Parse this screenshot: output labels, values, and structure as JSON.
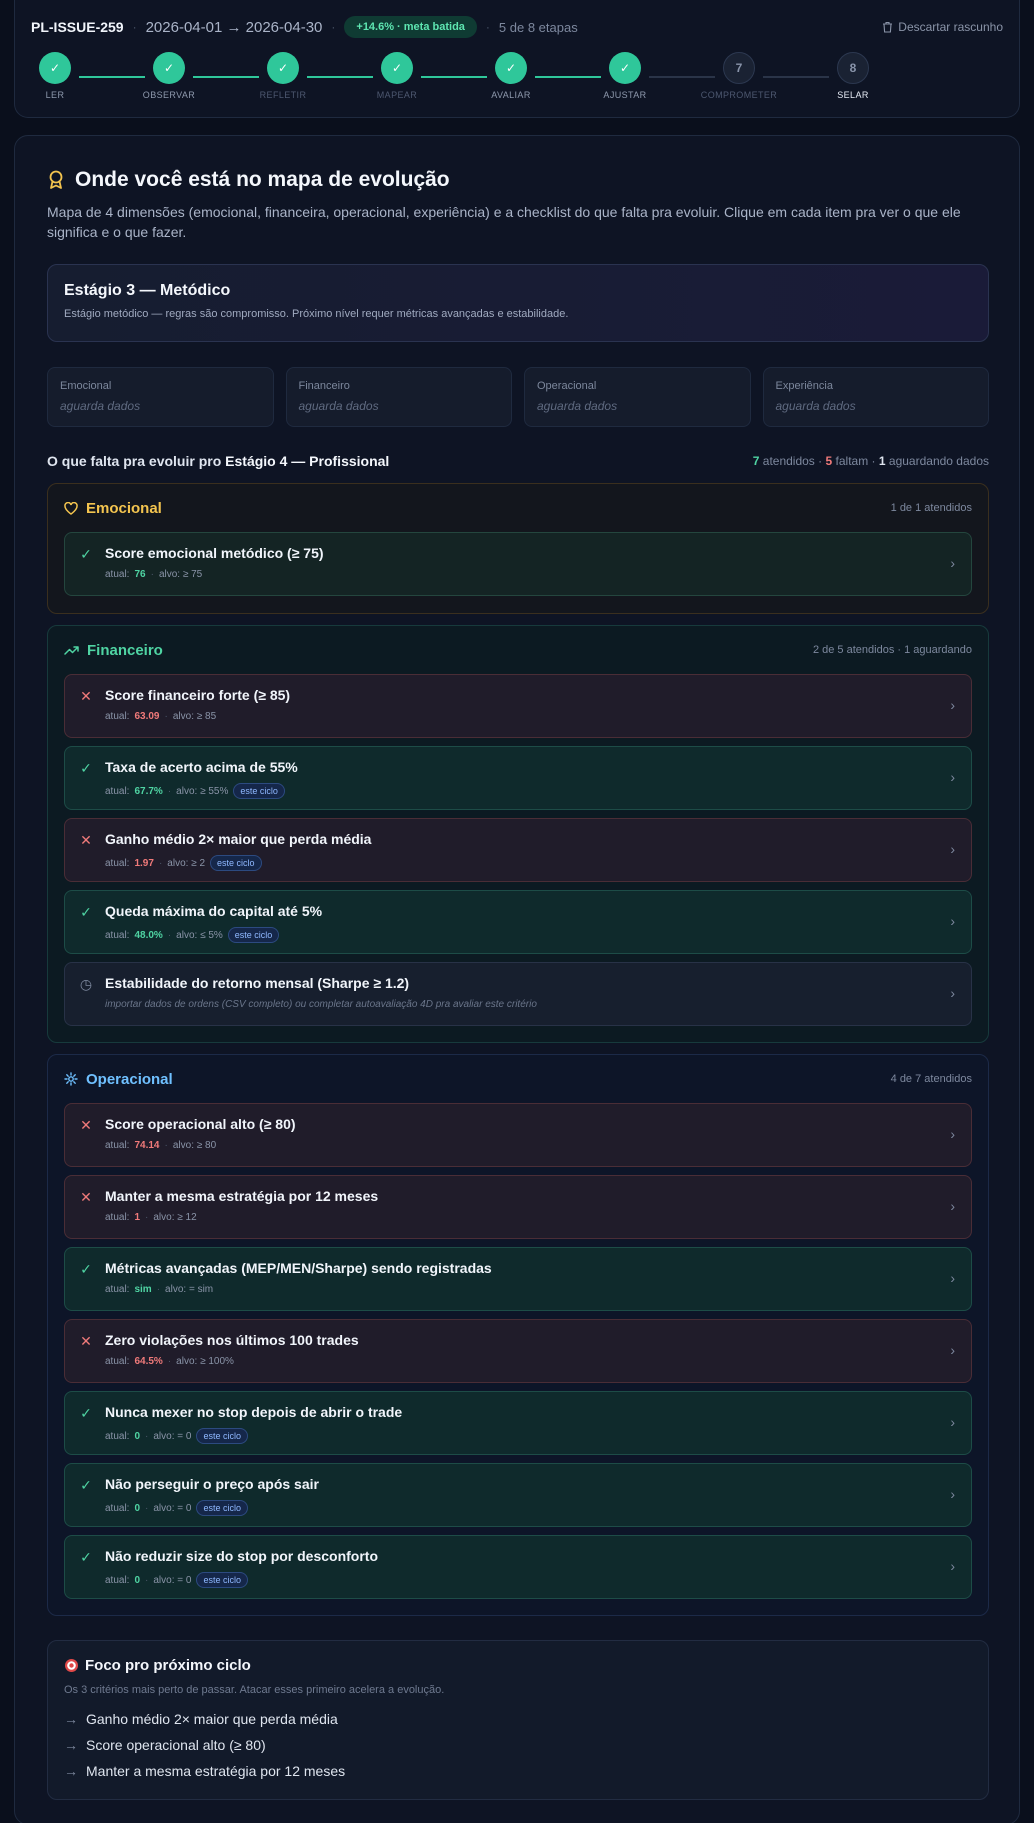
{
  "header": {
    "issue_id": "PL-ISSUE-259",
    "period": "2026-04-01 → 2026-04-30",
    "meta_badge": "+14.6% · meta batida",
    "steps_progress": "5 de 8 etapas",
    "discard_label": "Descartar rascunho"
  },
  "steps": [
    {
      "label": "LER",
      "state": "done",
      "marker": "✓"
    },
    {
      "label": "OBSERVAR",
      "state": "done",
      "marker": "✓"
    },
    {
      "label": "REFLETIR",
      "state": "done",
      "marker": "✓"
    },
    {
      "label": "MAPEAR",
      "state": "done",
      "marker": "✓"
    },
    {
      "label": "AVALIAR",
      "state": "done",
      "marker": "✓"
    },
    {
      "label": "AJUSTAR",
      "state": "done",
      "marker": "✓"
    },
    {
      "label": "COMPROMETER",
      "state": "todo",
      "marker": "7"
    },
    {
      "label": "SELAR",
      "state": "todo",
      "marker": "8"
    }
  ],
  "main": {
    "title": "Onde você está no mapa de evolução",
    "subtitle": "Mapa de 4 dimensões (emocional, financeira, operacional, experiência) e a checklist do que falta pra evoluir. Clique em cada item pra ver o que ele significa e o que fazer.",
    "stage": {
      "title": "Estágio 3 — Metódico",
      "description": "Estágio metódico — regras são compromisso. Próximo nível requer métricas avançadas e estabilidade."
    },
    "dimensions": [
      {
        "name": "Emocional",
        "value": "aguarda dados"
      },
      {
        "name": "Financeiro",
        "value": "aguarda dados"
      },
      {
        "name": "Operacional",
        "value": "aguarda dados"
      },
      {
        "name": "Experiência",
        "value": "aguarda dados"
      }
    ],
    "requirements": {
      "title_prefix": "O que falta pra evoluir pro",
      "title_target": "Estágio 4 — Profissional",
      "met_count": "7",
      "met_label": "atendidos",
      "missing_count": "5",
      "missing_label": "faltam",
      "waiting_count": "1",
      "waiting_label": "aguardando dados"
    },
    "groups": {
      "emocional": {
        "name": "Emocional",
        "count": "1 de 1 atendidos",
        "items": [
          {
            "title": "Score emocional metódico (≥ 75)",
            "current_label": "atual:",
            "current": "76",
            "target": "alvo: ≥ 75",
            "status": "ok"
          }
        ]
      },
      "financeiro": {
        "name": "Financeiro",
        "count": "2 de 5 atendidos · 1 aguardando",
        "items": [
          {
            "title": "Score financeiro forte (≥ 85)",
            "current_label": "atual:",
            "current": "63.09",
            "target": "alvo: ≥ 85",
            "status": "bad"
          },
          {
            "title": "Taxa de acerto acima de 55%",
            "current_label": "atual:",
            "current": "67.7%",
            "target": "alvo: ≥ 55%",
            "tag": "este ciclo",
            "status": "ok"
          },
          {
            "title": "Ganho médio 2× maior que perda média",
            "current_label": "atual:",
            "current": "1.97",
            "target": "alvo: ≥ 2",
            "tag": "este ciclo",
            "status": "bad"
          },
          {
            "title": "Queda máxima do capital até 5%",
            "current_label": "atual:",
            "current": "48.0%",
            "target": "alvo: ≤ 5%",
            "tag": "este ciclo",
            "status": "ok"
          },
          {
            "title": "Estabilidade do retorno mensal (Sharpe ≥ 1.2)",
            "note": "importar dados de ordens (CSV completo) ou completar autoavaliação 4D pra avaliar este critério",
            "status": "wait"
          }
        ]
      },
      "operacional": {
        "name": "Operacional",
        "count": "4 de 7 atendidos",
        "items": [
          {
            "title": "Score operacional alto (≥ 80)",
            "current_label": "atual:",
            "current": "74.14",
            "target": "alvo: ≥ 80",
            "status": "bad"
          },
          {
            "title": "Manter a mesma estratégia por 12 meses",
            "current_label": "atual:",
            "current": "1",
            "target": "alvo: ≥ 12",
            "status": "bad"
          },
          {
            "title": "Métricas avançadas (MEP/MEN/Sharpe) sendo registradas",
            "current_label": "atual:",
            "current": "sim",
            "target": "alvo: = sim",
            "status": "ok"
          },
          {
            "title": "Zero violações nos últimos 100 trades",
            "current_label": "atual:",
            "current": "64.5%",
            "target": "alvo: ≥ 100%",
            "status": "bad"
          },
          {
            "title": "Nunca mexer no stop depois de abrir o trade",
            "current_label": "atual:",
            "current": "0",
            "target": "alvo: = 0",
            "tag": "este ciclo",
            "status": "ok"
          },
          {
            "title": "Não perseguir o preço após sair",
            "current_label": "atual:",
            "current": "0",
            "target": "alvo: = 0",
            "tag": "este ciclo",
            "status": "ok"
          },
          {
            "title": "Não reduzir size do stop por desconforto",
            "current_label": "atual:",
            "current": "0",
            "target": "alvo: = 0",
            "tag": "este ciclo",
            "status": "ok"
          }
        ]
      }
    },
    "focus": {
      "title": "Foco pro próximo ciclo",
      "subtitle": "Os 3 critérios mais perto de passar. Atacar esses primeiro acelera a evolução.",
      "items": [
        "Ganho médio 2× maior que perda média",
        "Score operacional alto (≥ 80)",
        "Manter a mesma estratégia por 12 meses"
      ]
    }
  },
  "colors": {
    "accent_green": "#2fc79a",
    "danger": "#f07a7a",
    "emotional": "#f3c44f",
    "operational": "#6fc0ff"
  }
}
